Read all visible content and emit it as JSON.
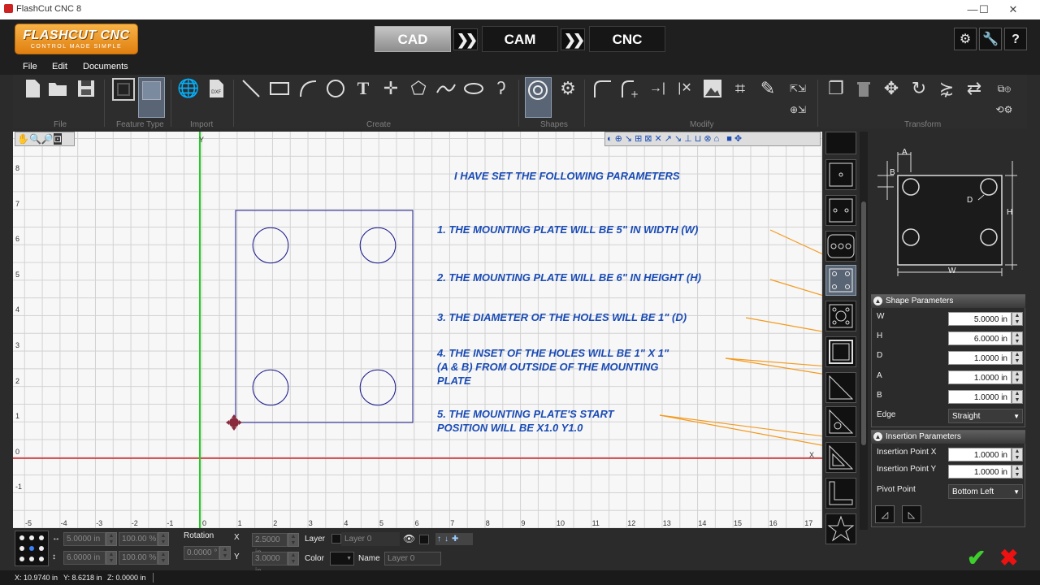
{
  "window": {
    "title": "FlashCut CNC 8",
    "min": "—",
    "max": "☐",
    "close": "✕"
  },
  "logo": {
    "name": "FLASHCUT CNC",
    "tagline": "CONTROL MADE SIMPLE"
  },
  "modes": {
    "cad": "CAD",
    "cam": "CAM",
    "cnc": "CNC",
    "arrow": "❯❯"
  },
  "header_buttons": {
    "settings": "⚙",
    "tools": "🔧",
    "help": "?"
  },
  "menu": {
    "file": "File",
    "edit": "Edit",
    "documents": "Documents"
  },
  "ribbon_groups": {
    "file": "File",
    "feature_type": "Feature Type",
    "import": "Import",
    "create": "Create",
    "shapes": "Shapes",
    "modify": "Modify",
    "transform": "Transform"
  },
  "axes": {
    "x": "X",
    "y": "Y"
  },
  "x_ticks": [
    "-5",
    "-4",
    "-3",
    "-2",
    "-1",
    "0",
    "1",
    "2",
    "3",
    "4",
    "5",
    "6",
    "7",
    "8",
    "9",
    "10",
    "11",
    "12",
    "13",
    "14",
    "15",
    "16",
    "17"
  ],
  "y_ticks": [
    "8",
    "7",
    "6",
    "5",
    "4",
    "3",
    "2",
    "1",
    "0",
    "-1"
  ],
  "annotations": {
    "heading": "I HAVE SET THE FOLLOWING PARAMETERS",
    "p1": "1. THE MOUNTING PLATE WILL BE 5\" IN WIDTH (W)",
    "p2": "2. THE MOUNTING PLATE WILL BE 6\" IN HEIGHT (H)",
    "p3": "3. THE DIAMETER OF THE HOLES WILL BE 1\" (D)",
    "p4a": "4. THE INSET OF THE HOLES WILL BE 1\" X 1\"",
    "p4b": "(A & B) FROM OUTSIDE OF THE MOUNTING",
    "p4c": "PLATE",
    "p5a": "5. THE MOUNTING PLATE'S START",
    "p5b": "POSITION WILL BE X1.0  Y1.0"
  },
  "diagram": {
    "a": "A",
    "b": "B",
    "d": "D",
    "h": "H",
    "w": "W"
  },
  "shape_params": {
    "title": "Shape Parameters",
    "w_label": "W",
    "w_value": "5.0000 in",
    "h_label": "H",
    "h_value": "6.0000 in",
    "d_label": "D",
    "d_value": "1.0000 in",
    "a_label": "A",
    "a_value": "1.0000 in",
    "b_label": "B",
    "b_value": "1.0000 in",
    "edge_label": "Edge",
    "edge_value": "Straight"
  },
  "insertion_params": {
    "title": "Insertion Parameters",
    "x_label": "Insertion Point X",
    "x_value": "1.0000 in",
    "y_label": "Insertion Point Y",
    "y_value": "1.0000 in",
    "pivot_label": "Pivot Point",
    "pivot_value": "Bottom Left"
  },
  "bottom": {
    "w": "5.0000 in",
    "h": "6.0000 in",
    "wp": "100.00 %",
    "hp": "100.00 %",
    "rotation_label": "Rotation",
    "rotation": "0.0000 °",
    "x_label": "X",
    "x": "2.5000 in",
    "y_label": "Y",
    "y": "3.0000 in",
    "layer_label": "Layer",
    "layer": "Layer 0",
    "color_label": "Color",
    "name_label": "Name",
    "name": "Layer 0"
  },
  "status": {
    "x": "X: 10.9740 in",
    "y": "Y: 8.6218 in",
    "z": "Z: 0.0000 in"
  },
  "actions": {
    "ok": "✔",
    "cancel": "✖"
  },
  "colors": {
    "accent": "#e8891a",
    "annotation": "#1a4bb5",
    "shape": "#1c1c8c",
    "x_axis": "#d42020",
    "y_axis": "#22cc22",
    "leader": "#f39a1e"
  }
}
